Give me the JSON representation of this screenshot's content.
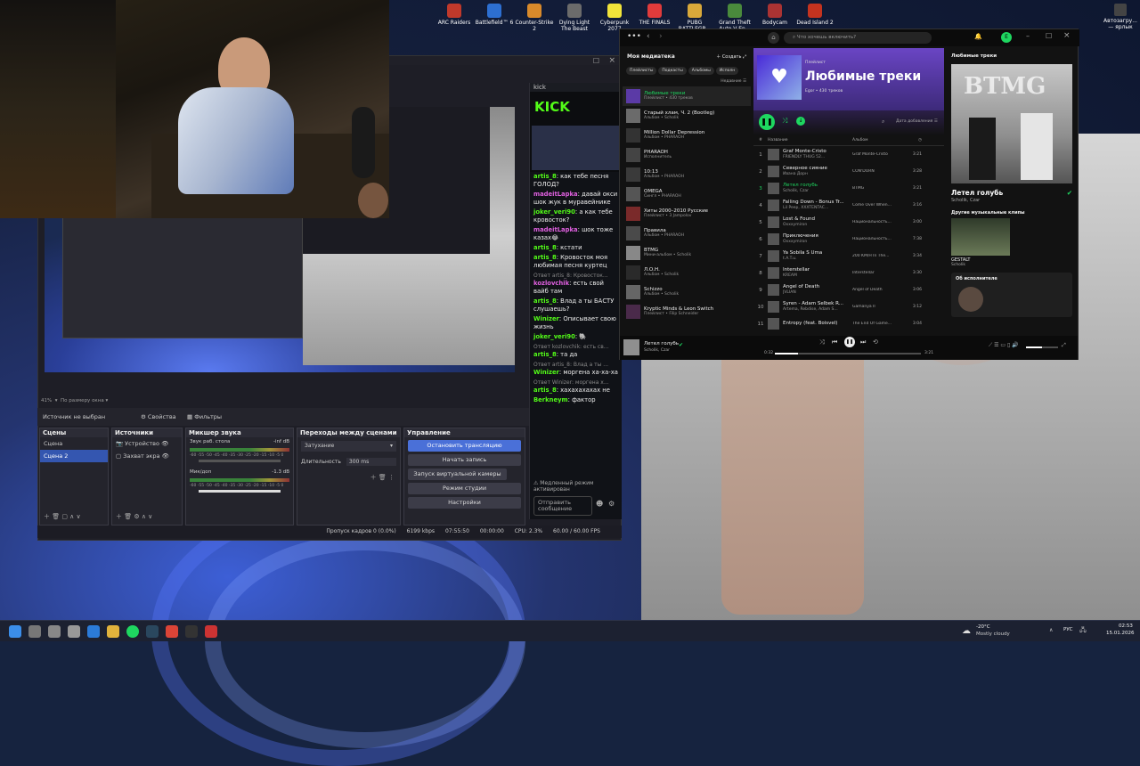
{
  "desktop": {
    "icons": [
      {
        "label": "ARC Raiders",
        "color": "#c0392b"
      },
      {
        "label": "Battlefield™ 6",
        "color": "#2d6fd1"
      },
      {
        "label": "Counter-Strike 2",
        "color": "#d98a2b"
      },
      {
        "label": "Dying Light The Beast",
        "color": "#6b6b6b"
      },
      {
        "label": "Cyberpunk 2077",
        "color": "#f2e43a"
      },
      {
        "label": "THE FINALS",
        "color": "#e03b3b"
      },
      {
        "label": "PUBG BATTLEGR...",
        "color": "#d8a83a"
      },
      {
        "label": "Grand Theft Auto V En...",
        "color": "#4a8a3c"
      },
      {
        "label": "Bodycam",
        "color": "#aa3333"
      },
      {
        "label": "Dead Island 2",
        "color": "#c4331f"
      }
    ],
    "right_icon": "Автозагру... — ярлык"
  },
  "obs": {
    "zoom": "41%",
    "scale_mode": "По размеру окна",
    "source_none": "Источник не выбран",
    "props_tab": "Свойства",
    "filters_tab": "Фильтры",
    "scenes": {
      "title": "Сцены",
      "items": [
        "Сцена",
        "Сцена 2"
      ]
    },
    "sources": {
      "title": "Источники",
      "items": [
        "Устройство",
        "Захват экра"
      ]
    },
    "mixer": {
      "title": "Микшер звука",
      "ch1_name": "Звук раб. стола",
      "ch1_db": "-inf dB",
      "ch2_name": "Мик/доп",
      "ch2_db": "-1.3 dB",
      "ticks": "-60 -55 -50 -45 -40 -35 -30 -25 -20 -15 -10 -5 0"
    },
    "transitions": {
      "title": "Переходы между сценами",
      "type": "Затухание",
      "duration_label": "Длительность",
      "duration": "300 ms"
    },
    "controls": {
      "title": "Управление",
      "stop_stream": "Остановить трансляцию",
      "start_record": "Начать запись",
      "virtual_cam": "Запуск виртуальной камеры",
      "studio": "Режим студии",
      "settings": "Настройки"
    },
    "status": {
      "dropped": "Пропуск кадров 0 (0.0%)",
      "bitrate": "6199 kbps",
      "live": "07:55:50",
      "rec": "00:00:00",
      "cpu": "CPU: 2.3%",
      "fps": "60.00 / 60.00 FPS"
    }
  },
  "kick": {
    "title": "kick",
    "logo": "KICK",
    "messages": [
      {
        "user": "artis_8",
        "text": "как тебе песня ГОЛОД?",
        "kind": "g"
      },
      {
        "user": "madeitLapka",
        "text": "давай окси шок жук в муравейнике",
        "kind": "p"
      },
      {
        "user": "joker_veri90",
        "text": "а как тебе кровосток?",
        "kind": "g"
      },
      {
        "user": "madeitLapka",
        "text": "шок тоже казах😂",
        "kind": "p"
      },
      {
        "user": "artis_8",
        "text": "кстати",
        "kind": "g"
      },
      {
        "user": "artis_8",
        "text": "Кровосток моя любимая песня куртец",
        "kind": "g"
      },
      {
        "user": "kozlovchik",
        "text": "есть свой вайб там",
        "kind": "r",
        "reply": "Ответ artis_8: Кровосток..."
      },
      {
        "user": "artis_8",
        "text": "Влад а ты БАСТУ слушаешь?",
        "kind": "g"
      },
      {
        "user": "Winizer",
        "text": "Описывает свою жизнь",
        "kind": "g"
      },
      {
        "user": "joker_veri90",
        "text": "🐘",
        "kind": "g"
      },
      {
        "user": "artis_8",
        "text": "та да",
        "kind": "g",
        "reply": "Ответ kozlovchik: есть св..."
      },
      {
        "user": "Winizer",
        "text": "моргена ха-ха-ха",
        "kind": "g",
        "reply": "Ответ artis_8: Влад а ты ..."
      },
      {
        "user": "artis_8",
        "text": "хахахахахах не",
        "kind": "g",
        "reply": "Ответ Winizer: моргена х..."
      },
      {
        "user": "Berkneym",
        "text": "фактор",
        "kind": "g"
      }
    ],
    "slow_mode": "Медленный режим активирован",
    "send_placeholder": "Отправить сообщение"
  },
  "spotify": {
    "search_placeholder": "Что хочешь включить?",
    "library_title": "Моя медиатека",
    "create": "Создать",
    "chips": [
      "Плейлисты",
      "Подкасты",
      "Альбомы",
      "Исполн"
    ],
    "recent": "Недавние",
    "library": [
      {
        "title": "Любимые треки",
        "sub": "Плейлист • 430 треков",
        "active": true
      },
      {
        "title": "Старый хлам, Ч. 2 (Bootleg)",
        "sub": "Альбом • Scholik"
      },
      {
        "title": "Million Dollar Depression",
        "sub": "Альбом • PHARAOH"
      },
      {
        "title": "PHARAOH",
        "sub": "Исполнитель"
      },
      {
        "title": "10:13",
        "sub": "Альбом • PHARAOH"
      },
      {
        "title": "OMEGA",
        "sub": "Сингл • PHARAOH"
      },
      {
        "title": "Хиты 2000–2010 Русские",
        "sub": "Плейлист • 3 Jampolov"
      },
      {
        "title": "Правила",
        "sub": "Альбом • PHARAOH"
      },
      {
        "title": "BTMG",
        "sub": "Мини-альбом • Scholik"
      },
      {
        "title": "Л.О.Н.",
        "sub": "Альбом • Scholik"
      },
      {
        "title": "Schizzo",
        "sub": "Альбом • Scholik"
      },
      {
        "title": "Kryptic Minds & Leon Switch",
        "sub": "Плейлист • Filip Schneider"
      }
    ],
    "playlist": {
      "type": "Плейлист",
      "title": "Любимые треки",
      "meta": "Egor • 430 треков",
      "sort": "Дата добавления"
    },
    "headers": {
      "num": "#",
      "name": "Название",
      "album": "Альбом"
    },
    "tracks": [
      {
        "n": "1",
        "title": "Graf Monte-Cristo",
        "artist": "FRIENDLY THUG 52...",
        "album": "Graf Monte-Cristo",
        "dur": "3:21"
      },
      {
        "n": "2",
        "title": "Северное сияние",
        "artist": "Ивана Дорн",
        "album": "CON'DORN",
        "dur": "3:28"
      },
      {
        "n": "3",
        "title": "Летел голубь",
        "artist": "Scholik, Czar",
        "album": "BTMG",
        "dur": "3:21",
        "playing": true
      },
      {
        "n": "4",
        "title": "Falling Down - Bonus Tr...",
        "artist": "Lil Peep, XXXTENTAC...",
        "album": "Come Over When...",
        "dur": "3:16"
      },
      {
        "n": "5",
        "title": "Lost & Found",
        "artist": "Oxxxymiron",
        "album": "Национальность...",
        "dur": "3:00"
      },
      {
        "n": "6",
        "title": "Приключения",
        "artist": "Oxxxymiron",
        "album": "Национальность...",
        "dur": "7:38"
      },
      {
        "n": "7",
        "title": "Ya Sobila S Uma",
        "artist": "t.A.T.u.",
        "album": "200 KM/H In The...",
        "dur": "3:34"
      },
      {
        "n": "8",
        "title": "Interstellar",
        "artist": "KREAM",
        "album": "Interstellar",
        "dur": "3:30"
      },
      {
        "n": "9",
        "title": "Angel of Death",
        "artist": "JVLIAN",
        "album": "Angel of Death",
        "dur": "3:06"
      },
      {
        "n": "10",
        "title": "Syren - Adam Selbek R...",
        "artist": "Artema, Rebdise, Adam S...",
        "album": "Gamanya II",
        "dur": "3:12"
      },
      {
        "n": "11",
        "title": "Entropy (feat. Boisvel)",
        "artist": "",
        "album": "The End Of Game...",
        "dur": "3:04"
      }
    ],
    "right": {
      "header": "Любимые треки",
      "cover_text": "BTMG",
      "song": "Летел голубь",
      "artists": "Scholik, Czar",
      "other_clips": "Другие музыкальные клипы",
      "clip_title": "GESTALT",
      "clip_artist": "Scholik",
      "about": "Об исполнителе"
    },
    "now_playing": {
      "title": "Летел голубь",
      "artist": "Scholik, Czar",
      "elapsed": "0:32",
      "total": "3:21",
      "progress": 0.16,
      "volume": 0.5
    }
  },
  "taskbar": {
    "weather_temp": "-20°C",
    "weather_desc": "Mostly cloudy",
    "lang": "РУС",
    "time": "02:53",
    "date": "15.01.2026"
  },
  "colors": {
    "kick_green": "#53fc18",
    "spotify_green": "#1ed760",
    "obs_blue": "#4a70d8",
    "spotify_purple": "#5b3aa6"
  }
}
